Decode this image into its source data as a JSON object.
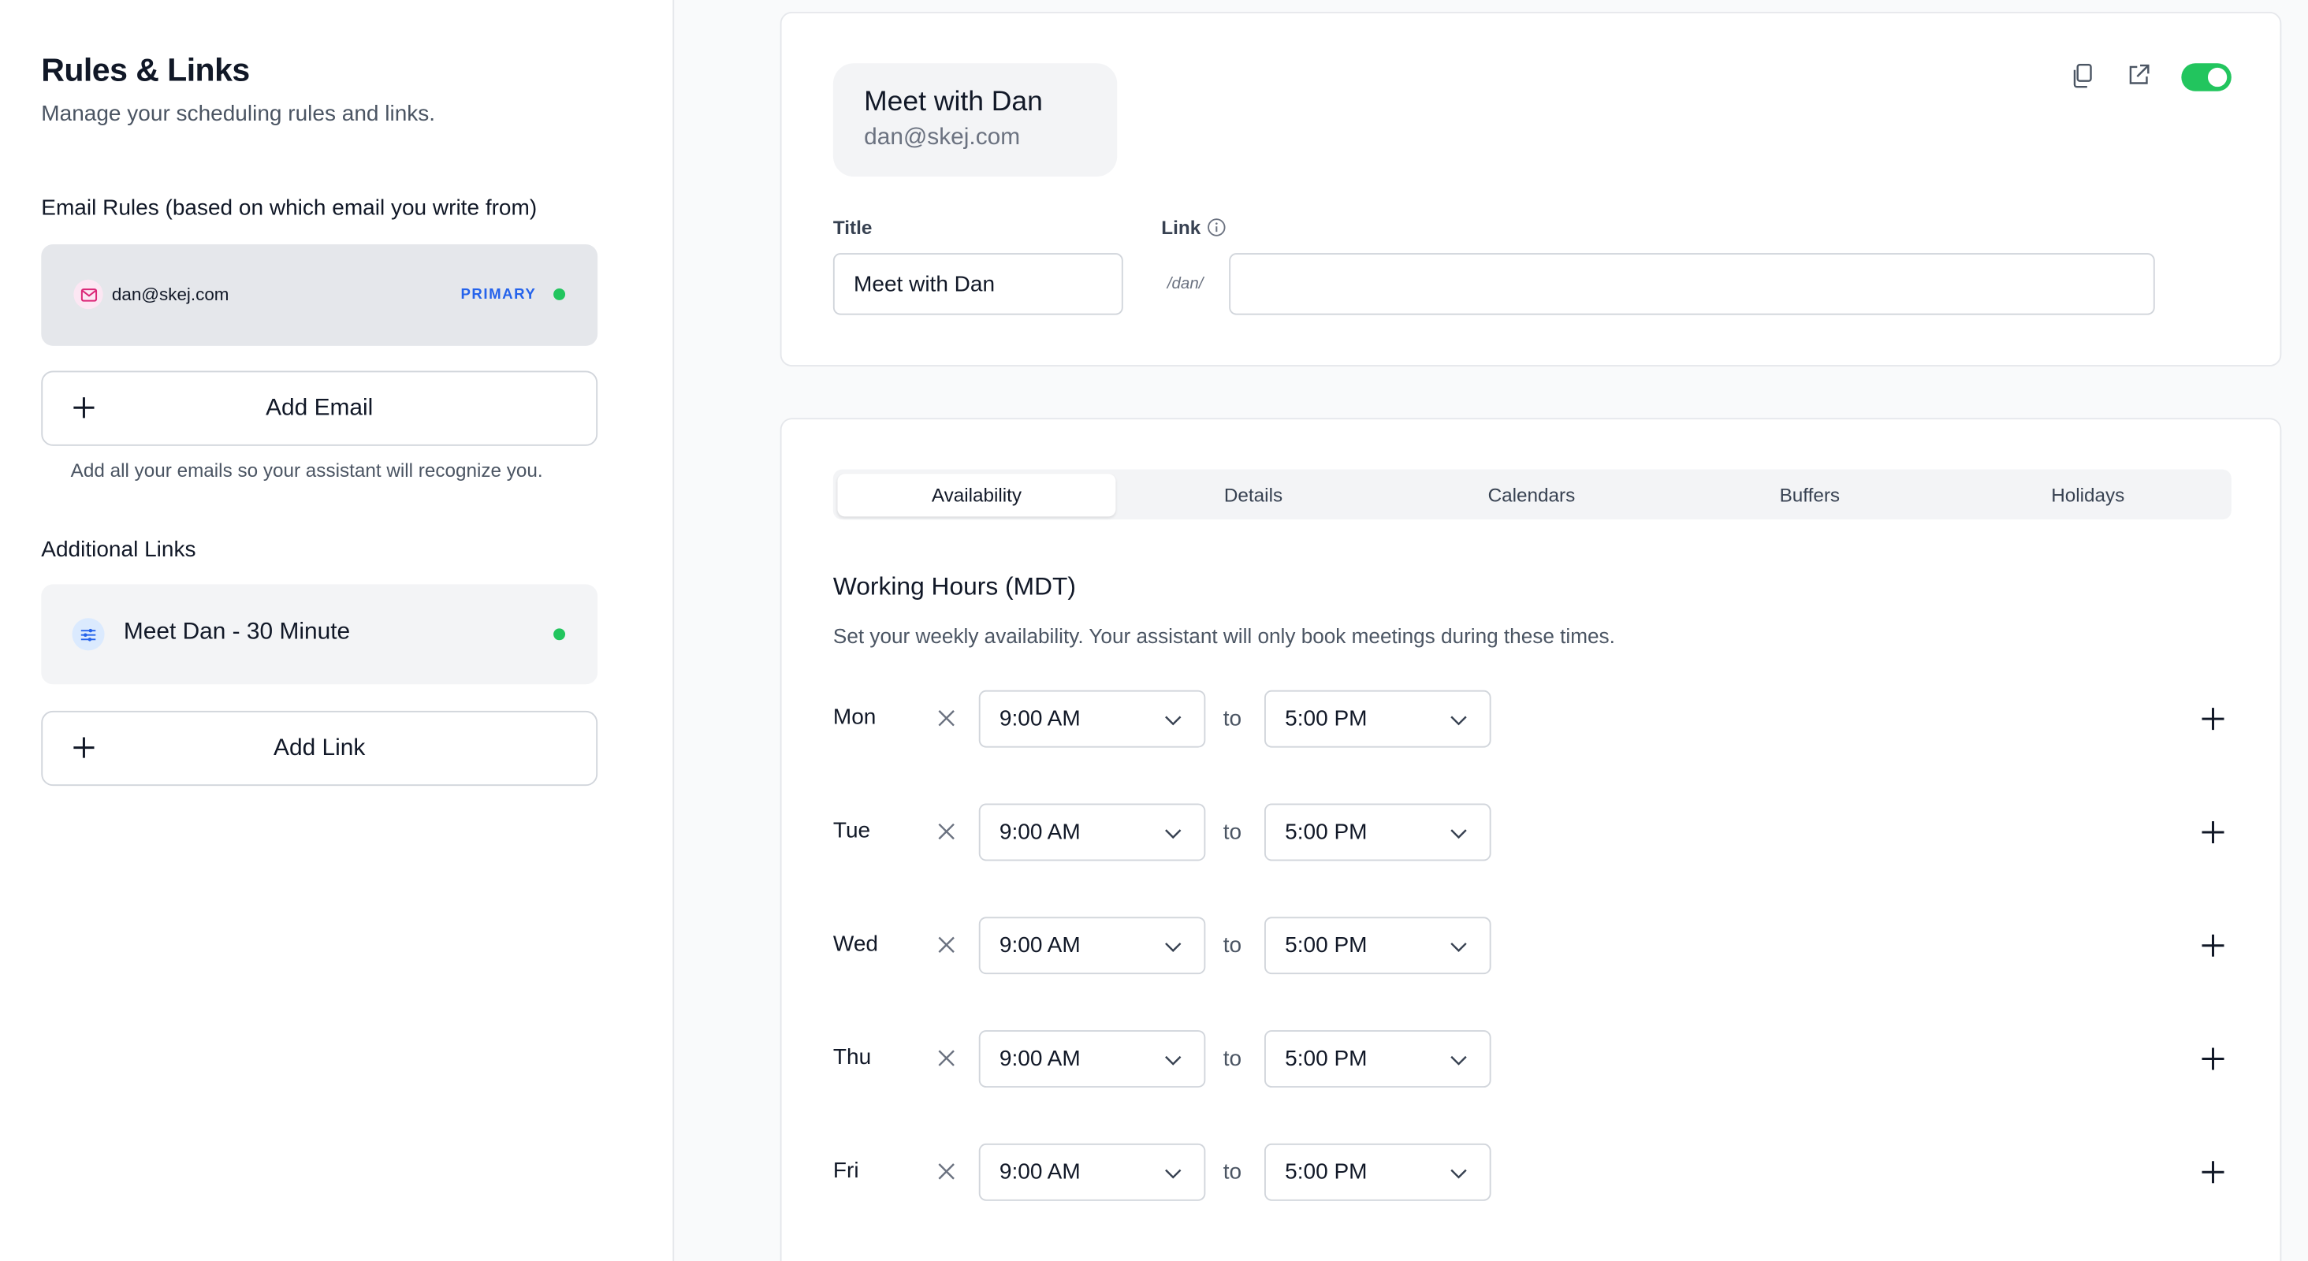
{
  "sidebar": {
    "title": "Rules & Links",
    "subtitle": "Manage your scheduling rules and links.",
    "email_rules_heading": "Email Rules (based on which email you write from)",
    "email_item": {
      "email": "dan@skej.com",
      "badge": "PRIMARY"
    },
    "add_email_label": "Add Email",
    "add_email_hint": "Add all your emails so your assistant will recognize you.",
    "additional_links_heading": "Additional Links",
    "link_item": {
      "label": "Meet Dan - 30 Minute"
    },
    "add_link_label": "Add Link"
  },
  "profile": {
    "name": "Meet with Dan",
    "email": "dan@skej.com",
    "title_label": "Title",
    "title_value": "Meet with Dan",
    "link_label": "Link",
    "link_prefix": "/dan/",
    "link_value": ""
  },
  "tabs": [
    "Availability",
    "Details",
    "Calendars",
    "Buffers",
    "Holidays"
  ],
  "active_tab": "Availability",
  "working_hours": {
    "title": "Working Hours (MDT)",
    "subtitle": "Set your weekly availability. Your assistant will only book meetings during these times.",
    "to_label": "to",
    "days": [
      {
        "day": "Mon",
        "start": "9:00 AM",
        "end": "5:00 PM"
      },
      {
        "day": "Tue",
        "start": "9:00 AM",
        "end": "5:00 PM"
      },
      {
        "day": "Wed",
        "start": "9:00 AM",
        "end": "5:00 PM"
      },
      {
        "day": "Thu",
        "start": "9:00 AM",
        "end": "5:00 PM"
      },
      {
        "day": "Fri",
        "start": "9:00 AM",
        "end": "5:00 PM"
      }
    ]
  },
  "colors": {
    "accent_green": "#22c55e",
    "primary_blue": "#2563eb"
  },
  "toggle_enabled": true
}
